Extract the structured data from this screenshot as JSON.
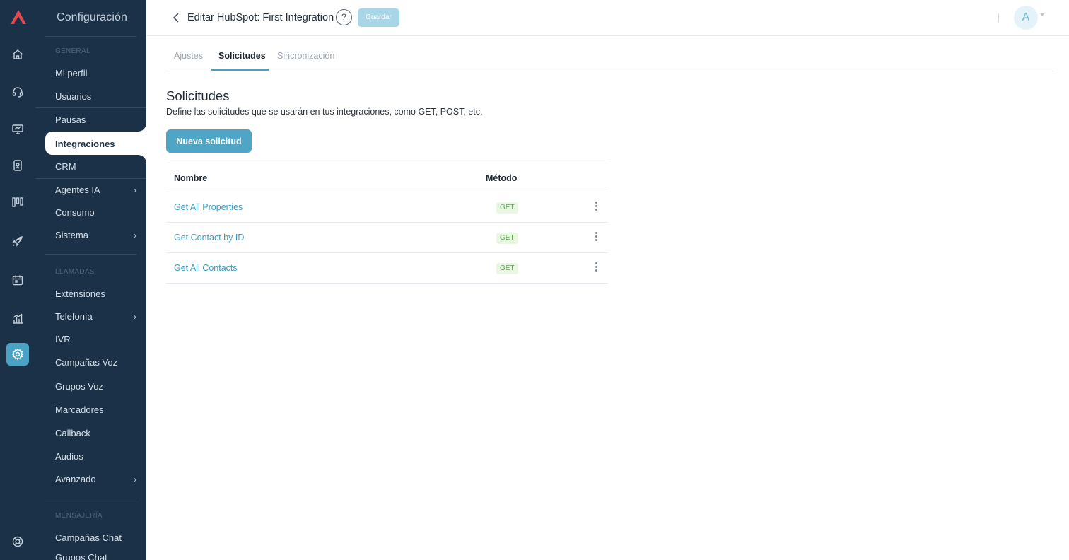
{
  "sidebar": {
    "title": "Configuración",
    "sections": {
      "general": "GENERAL",
      "llamadas": "LLAMADAS",
      "mensajeria": "MENSAJERÍA"
    },
    "items": {
      "mi_perfil": "Mi perfil",
      "usuarios": "Usuarios",
      "pausas": "Pausas",
      "integraciones": "Integraciones",
      "crm": "CRM",
      "agentes_ia": "Agentes IA",
      "consumo": "Consumo",
      "sistema": "Sistema",
      "extensiones": "Extensiones",
      "telefonia": "Telefonía",
      "ivr": "IVR",
      "campanas_voz": "Campañas Voz",
      "grupos_voz": "Grupos Voz",
      "marcadores": "Marcadores",
      "callback": "Callback",
      "audios": "Audios",
      "avanzado": "Avanzado",
      "campanas_chat": "Campañas Chat",
      "grupos_chat": "Grupos Chat"
    },
    "chevron": "›"
  },
  "rail_icons": [
    "home-icon",
    "headset-icon",
    "monitor-icon",
    "contacts-icon",
    "kanban-icon",
    "rocket-icon",
    "calendar-icon",
    "reports-icon",
    "settings-icon",
    "support-icon"
  ],
  "header": {
    "title": "Editar HubSpot: First Integration",
    "help": "?",
    "save_label": "Guardar",
    "avatar_initial": "A"
  },
  "tabs": {
    "ajustes": "Ajustes",
    "solicitudes": "Solicitudes",
    "sincronizacion": "Sincronización"
  },
  "content": {
    "heading": "Solicitudes",
    "description": "Define las solicitudes que se usarán en tus integraciones, como GET, POST, etc.",
    "new_button": "Nueva solicitud"
  },
  "table": {
    "columns": {
      "name": "Nombre",
      "method": "Método"
    },
    "rows": [
      {
        "name": "Get All Properties",
        "method": "GET"
      },
      {
        "name": "Get Contact by ID",
        "method": "GET"
      },
      {
        "name": "Get All Contacts",
        "method": "GET"
      }
    ]
  },
  "colors": {
    "sidebar_bg": "#1b3148",
    "accent": "#4aa3c4",
    "method_badge_bg": "#e9f7e4",
    "method_badge_text": "#5aa94a"
  }
}
